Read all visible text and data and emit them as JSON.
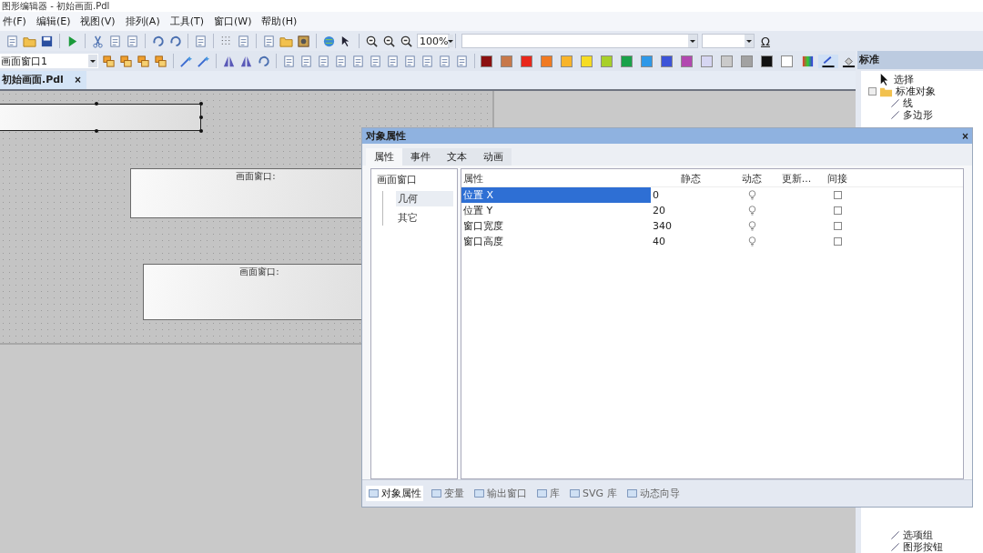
{
  "window": {
    "title": "图形编辑器 - 初始画面.Pdl"
  },
  "menu": [
    "件(F)",
    "编辑(E)",
    "视图(V)",
    "排列(A)",
    "工具(T)",
    "窗口(W)",
    "帮助(H)"
  ],
  "toolbar": {
    "zoom": "100%",
    "symbol_button": "Ω"
  },
  "object_selector": {
    "value": "画面窗口1"
  },
  "palette": [
    {
      "color": "#8b1010"
    },
    {
      "color": "#c7784a"
    },
    {
      "color": "#e8281c"
    },
    {
      "color": "#f07a22"
    },
    {
      "color": "#f8b42a"
    },
    {
      "color": "#f6dc24"
    },
    {
      "color": "#a8d02a"
    },
    {
      "color": "#1aa24a"
    },
    {
      "color": "#2e98e8"
    },
    {
      "color": "#3c54d8"
    },
    {
      "color": "#b248b0"
    },
    {
      "color": "#d6d6f2"
    },
    {
      "color": "#cacaca"
    },
    {
      "color": "#a2a2a2"
    },
    {
      "color": "#111111"
    },
    {
      "color": "#ffffff"
    }
  ],
  "document_tabs": [
    {
      "label": "初始画面.Pdl",
      "selected": true,
      "close": "×"
    }
  ],
  "canvas": {
    "objects": [
      {
        "selected": true
      },
      {
        "caption": "画面窗口:",
        "selected": false
      },
      {
        "caption": "画面窗口:",
        "selected": false
      }
    ]
  },
  "object_palette": {
    "title": "标准",
    "items": [
      {
        "label": "选择"
      },
      {
        "label": "标准对象",
        "expanded": true,
        "children": [
          {
            "label": "线"
          },
          {
            "label": "多边形"
          },
          {
            "label": "选项组"
          },
          {
            "label": "图形按钮"
          }
        ]
      }
    ]
  },
  "dialog": {
    "title": "对象属性",
    "close": "×",
    "tabs": [
      {
        "label": "属性",
        "selected": true
      },
      {
        "label": "事件",
        "selected": false
      },
      {
        "label": "文本",
        "selected": false
      },
      {
        "label": "动画",
        "selected": false
      }
    ],
    "tree": [
      {
        "label": "画面窗口",
        "selected": false,
        "children": [
          {
            "label": "几何",
            "selected": true
          },
          {
            "label": "其它",
            "selected": false
          }
        ]
      }
    ],
    "table": {
      "columns": [
        "属性",
        "静态",
        "动态",
        "更新...",
        "间接"
      ],
      "rows": [
        {
          "name": "位置 X",
          "static": "0",
          "selected": true,
          "indirect": false
        },
        {
          "name": "位置 Y",
          "static": "20",
          "selected": false,
          "indirect": false
        },
        {
          "name": "窗口宽度",
          "static": "340",
          "selected": false,
          "indirect": false
        },
        {
          "name": "窗口高度",
          "static": "40",
          "selected": false,
          "indirect": false
        }
      ]
    },
    "bottom_tabs": [
      {
        "label": "对象属性",
        "selected": true
      },
      {
        "label": "变量",
        "selected": false
      },
      {
        "label": "输出窗口",
        "selected": false
      },
      {
        "label": "库",
        "selected": false
      },
      {
        "label": "SVG 库",
        "selected": false
      },
      {
        "label": "动态向导",
        "selected": false
      }
    ]
  }
}
